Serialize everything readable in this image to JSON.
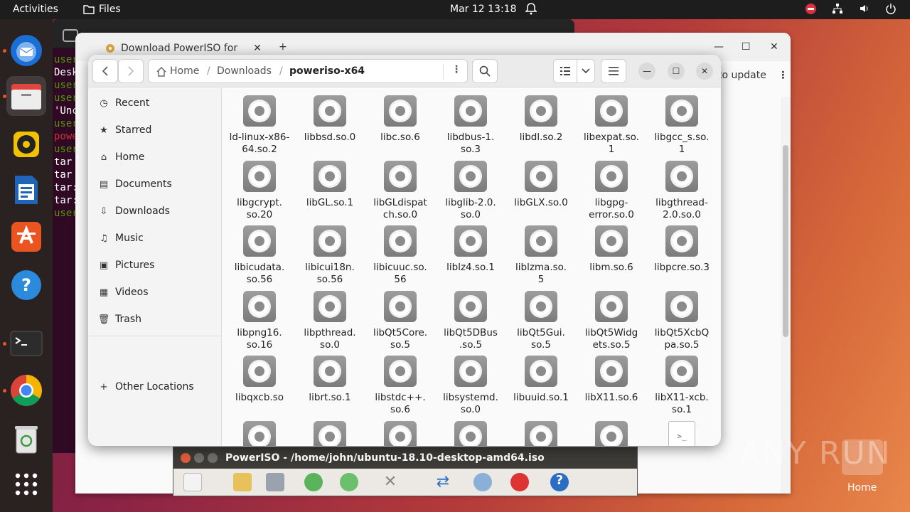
{
  "topbar": {
    "activities": "Activities",
    "app_name": "Files",
    "clock": "Mar 12  13:18"
  },
  "terminal": {
    "lines": [
      {
        "text": "user",
        "color": "#4e9a06"
      },
      {
        "text": "Desk",
        "color": "#ffffff"
      },
      {
        "text": "user",
        "color": "#4e9a06"
      },
      {
        "text": "user",
        "color": "#4e9a06"
      },
      {
        "text": "'Unc",
        "color": "#ffffff"
      },
      {
        "text": "user",
        "color": "#4e9a06"
      },
      {
        "text": "powe",
        "color": "#cc3333"
      },
      {
        "text": "user",
        "color": "#4e9a06"
      },
      {
        "text": "tar",
        "color": "#ffffff"
      },
      {
        "text": "tar",
        "color": "#ffffff"
      },
      {
        "text": "tar:",
        "color": "#ffffff"
      },
      {
        "text": "tar:",
        "color": "#ffffff"
      },
      {
        "text": "user",
        "color": "#4e9a06"
      }
    ]
  },
  "browser": {
    "tab_title": "Download PowerISO for",
    "new_tab": "+",
    "update_label": "to update"
  },
  "files": {
    "breadcrumb": {
      "home": "Home",
      "downloads": "Downloads",
      "current": "poweriso-x64"
    },
    "sidebar": [
      {
        "label": "Recent",
        "icon": "clock-icon"
      },
      {
        "label": "Starred",
        "icon": "star-icon"
      },
      {
        "label": "Home",
        "icon": "home-icon"
      },
      {
        "label": "Documents",
        "icon": "document-icon"
      },
      {
        "label": "Downloads",
        "icon": "download-icon"
      },
      {
        "label": "Music",
        "icon": "music-icon"
      },
      {
        "label": "Pictures",
        "icon": "pictures-icon"
      },
      {
        "label": "Videos",
        "icon": "videos-icon"
      },
      {
        "label": "Trash",
        "icon": "trash-icon"
      }
    ],
    "other_locations": "Other Locations",
    "items": [
      "ld-linux-x86-64.so.2",
      "libbsd.so.0",
      "libc.so.6",
      "libdbus-1.so.3",
      "libdl.so.2",
      "libexpat.so.1",
      "libgcc_s.so.1",
      "libgcrypt.so.20",
      "libGL.so.1",
      "libGLdispatch.so.0",
      "libglib-2.0.so.0",
      "libGLX.so.0",
      "libgpg-error.so.0",
      "libgthread-2.0.so.0",
      "libicudata.so.56",
      "libicui18n.so.56",
      "libicuuc.so.56",
      "liblz4.so.1",
      "liblzma.so.5",
      "libm.so.6",
      "libpcre.so.3",
      "libpng16.so.16",
      "libpthread.so.0",
      "libQt5Core.so.5",
      "libQt5DBus.so.5",
      "libQt5Gui.so.5",
      "libQt5Widgets.so.5",
      "libQt5XcbQpa.so.5",
      "libqxcb.so",
      "librt.so.1",
      "libstdc++.so.6",
      "libsystemd.so.0",
      "libuuid.so.1",
      "libX11.so.6",
      "libX11-xcb.so.1"
    ],
    "item_lines": [
      [
        "ld-linux-x86-",
        "64.so.2"
      ],
      [
        "libbsd.so.0"
      ],
      [
        "libc.so.6"
      ],
      [
        "libdbus-1.",
        "so.3"
      ],
      [
        "libdl.so.2"
      ],
      [
        "libexpat.so.",
        "1"
      ],
      [
        "libgcc_s.so.",
        "1"
      ],
      [
        "libgcrypt.",
        "so.20"
      ],
      [
        "libGL.so.1"
      ],
      [
        "libGLdispat",
        "ch.so.0"
      ],
      [
        "libglib-2.0.",
        "so.0"
      ],
      [
        "libGLX.so.0"
      ],
      [
        "libgpg-",
        "error.so.0"
      ],
      [
        "libgthread-",
        "2.0.so.0"
      ],
      [
        "libicudata.",
        "so.56"
      ],
      [
        "libicui18n.",
        "so.56"
      ],
      [
        "libicuuc.so.",
        "56"
      ],
      [
        "liblz4.so.1"
      ],
      [
        "liblzma.so.",
        "5"
      ],
      [
        "libm.so.6"
      ],
      [
        "libpcre.so.3"
      ],
      [
        "libpng16.",
        "so.16"
      ],
      [
        "libpthread.",
        "so.0"
      ],
      [
        "libQt5Core.",
        "so.5"
      ],
      [
        "libQt5DBus",
        ".so.5"
      ],
      [
        "libQt5Gui.",
        "so.5"
      ],
      [
        "libQt5Widg",
        "ets.so.5"
      ],
      [
        "libQt5XcbQ",
        "pa.so.5"
      ],
      [
        "libqxcb.so"
      ],
      [
        "librt.so.1"
      ],
      [
        "libstdc++.",
        "so.6"
      ],
      [
        "libsystemd.",
        "so.0"
      ],
      [
        "libuuid.so.1"
      ],
      [
        "libX11.so.6"
      ],
      [
        "libX11-xcb.",
        "so.1"
      ]
    ]
  },
  "poweriso": {
    "title": "PowerISO - /home/john/ubuntu-18.10-desktop-amd64.iso"
  },
  "watermark": "ANY RUN",
  "desktop_home_label": "Home",
  "colors": {
    "accent": "#e95420",
    "topbar": "#1d1d1d",
    "dock": "#2a2121"
  }
}
